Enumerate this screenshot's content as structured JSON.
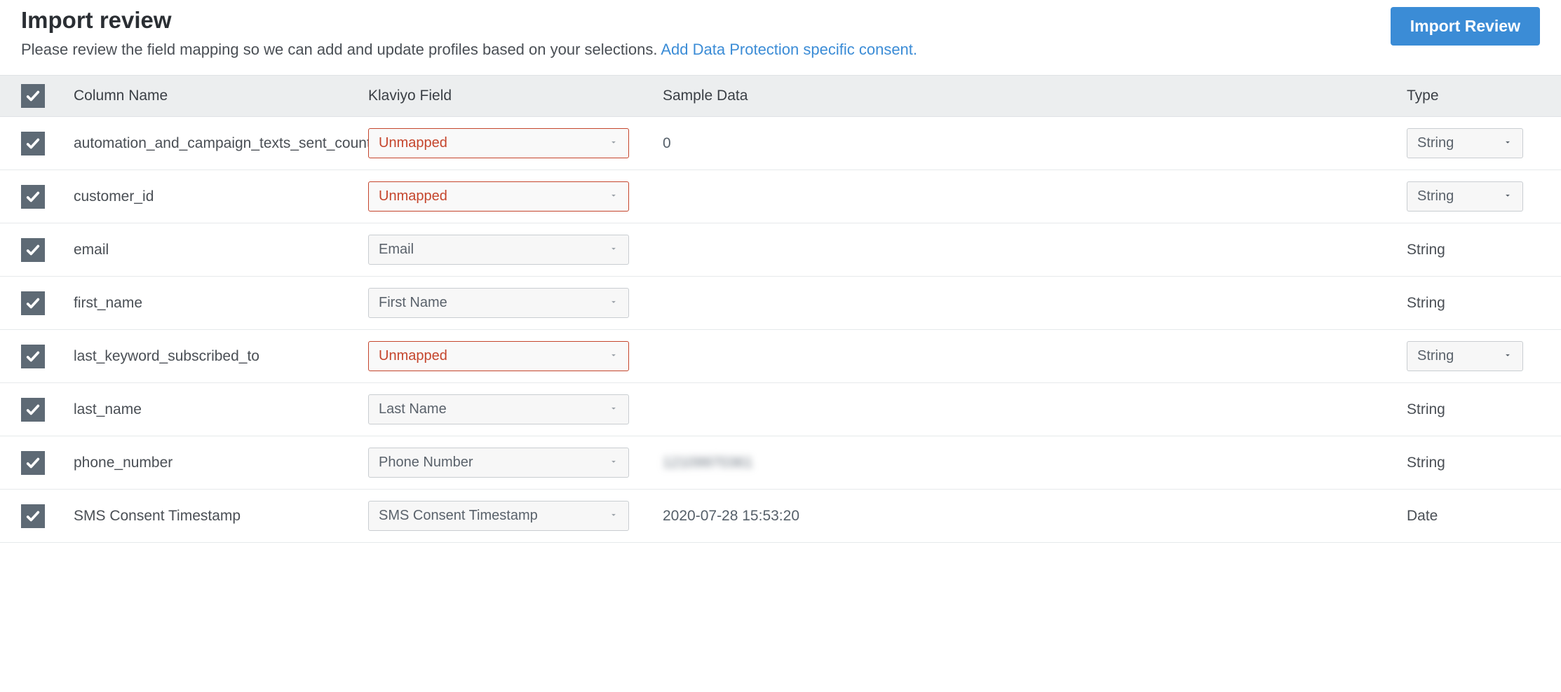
{
  "header": {
    "title": "Import review",
    "subtitle": "Please review the field mapping so we can add and update profiles based on your selections.",
    "link_text": "Add Data Protection specific consent.",
    "button_label": "Import Review"
  },
  "table": {
    "headers": {
      "column_name": "Column Name",
      "klaviyo_field": "Klaviyo Field",
      "sample_data": "Sample Data",
      "type": "Type"
    },
    "rows": [
      {
        "checked": true,
        "column_name": "automation_and_campaign_texts_sent_count",
        "klaviyo_field": "Unmapped",
        "field_unmapped": true,
        "sample_data": "0",
        "sample_blurred": false,
        "type": "String",
        "type_editable": true
      },
      {
        "checked": true,
        "column_name": "customer_id",
        "klaviyo_field": "Unmapped",
        "field_unmapped": true,
        "sample_data": "",
        "sample_blurred": false,
        "type": "String",
        "type_editable": true
      },
      {
        "checked": true,
        "column_name": "email",
        "klaviyo_field": "Email",
        "field_unmapped": false,
        "sample_data": "",
        "sample_blurred": false,
        "type": "String",
        "type_editable": false
      },
      {
        "checked": true,
        "column_name": "first_name",
        "klaviyo_field": "First Name",
        "field_unmapped": false,
        "sample_data": "",
        "sample_blurred": false,
        "type": "String",
        "type_editable": false
      },
      {
        "checked": true,
        "column_name": "last_keyword_subscribed_to",
        "klaviyo_field": "Unmapped",
        "field_unmapped": true,
        "sample_data": "",
        "sample_blurred": false,
        "type": "String",
        "type_editable": true
      },
      {
        "checked": true,
        "column_name": "last_name",
        "klaviyo_field": "Last Name",
        "field_unmapped": false,
        "sample_data": "",
        "sample_blurred": false,
        "type": "String",
        "type_editable": false
      },
      {
        "checked": true,
        "column_name": "phone_number",
        "klaviyo_field": "Phone Number",
        "field_unmapped": false,
        "sample_data": "12109970361",
        "sample_blurred": true,
        "type": "String",
        "type_editable": false
      },
      {
        "checked": true,
        "column_name": "SMS Consent Timestamp",
        "klaviyo_field": "SMS Consent Timestamp",
        "field_unmapped": false,
        "sample_data": "2020-07-28 15:53:20",
        "sample_blurred": false,
        "type": "Date",
        "type_editable": false
      }
    ]
  }
}
